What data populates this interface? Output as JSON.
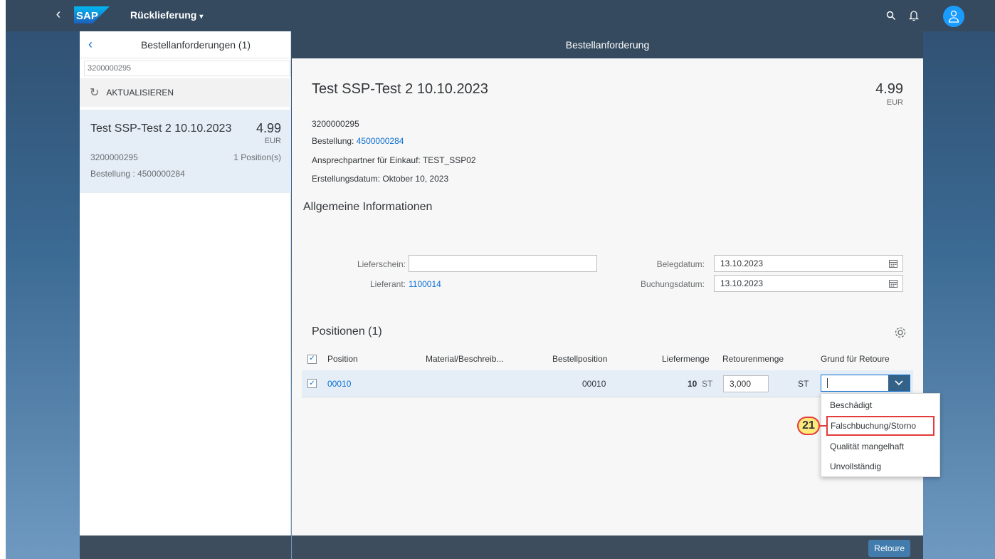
{
  "shell": {
    "app_title": "Rücklieferung",
    "logo_text": "SAP",
    "colors": {
      "shell_bg": "#354a5f",
      "avatar": "#1a9cff"
    },
    "icons": [
      "back-icon",
      "search-icon",
      "bell-icon",
      "user-icon",
      "caret-down-icon"
    ]
  },
  "master": {
    "title": "Bestellanforderungen (1)",
    "search_value": "3200000295",
    "refresh_label": "AKTUALISIEREN",
    "items": [
      {
        "title": "Test SSP-Test 2 10.10.2023",
        "amount": "4.99",
        "currency": "EUR",
        "number": "3200000295",
        "positions": "1 Position(s)",
        "order": "Bestellung : 4500000284"
      }
    ]
  },
  "detail": {
    "header": "Bestellanforderung",
    "object": {
      "title": "Test SSP-Test 2 10.10.2023",
      "amount": "4.99",
      "currency": "EUR",
      "number": "3200000295",
      "order_label": "Bestellung:",
      "order_value": "4500000284",
      "contact": "Ansprechpartner für Einkauf: TEST_SSP02",
      "created": "Erstellungsdatum: Oktober 10, 2023"
    },
    "general_section": "Allgemeine Informationen",
    "form": {
      "lieferschein_label": "Lieferschein:",
      "lieferschein_value": "",
      "lieferant_label": "Lieferant:",
      "lieferant_value": "1100014",
      "belegdatum_label": "Belegdatum:",
      "belegdatum_value": "13.10.2023",
      "buchungsdatum_label": "Buchungsdatum:",
      "buchungsdatum_value": "13.10.2023"
    },
    "positions": {
      "title": "Positionen (1)",
      "columns": [
        "Position",
        "Material/Beschreib...",
        "Bestellposition",
        "Liefermenge",
        "Retourenmenge",
        "Grund für Retoure"
      ],
      "rows": [
        {
          "position": "00010",
          "material": "",
          "order_position": "00010",
          "delivered_qty": "10",
          "delivered_unit": "ST",
          "return_qty": "3,000",
          "return_unit": "ST",
          "reason": ""
        }
      ]
    },
    "reason_options": [
      "Beschädigt",
      "Falschbuchung/Storno",
      "Qualität mangelhaft",
      "Unvollständig"
    ],
    "callout_number": "21",
    "footer_button": "Retoure"
  }
}
